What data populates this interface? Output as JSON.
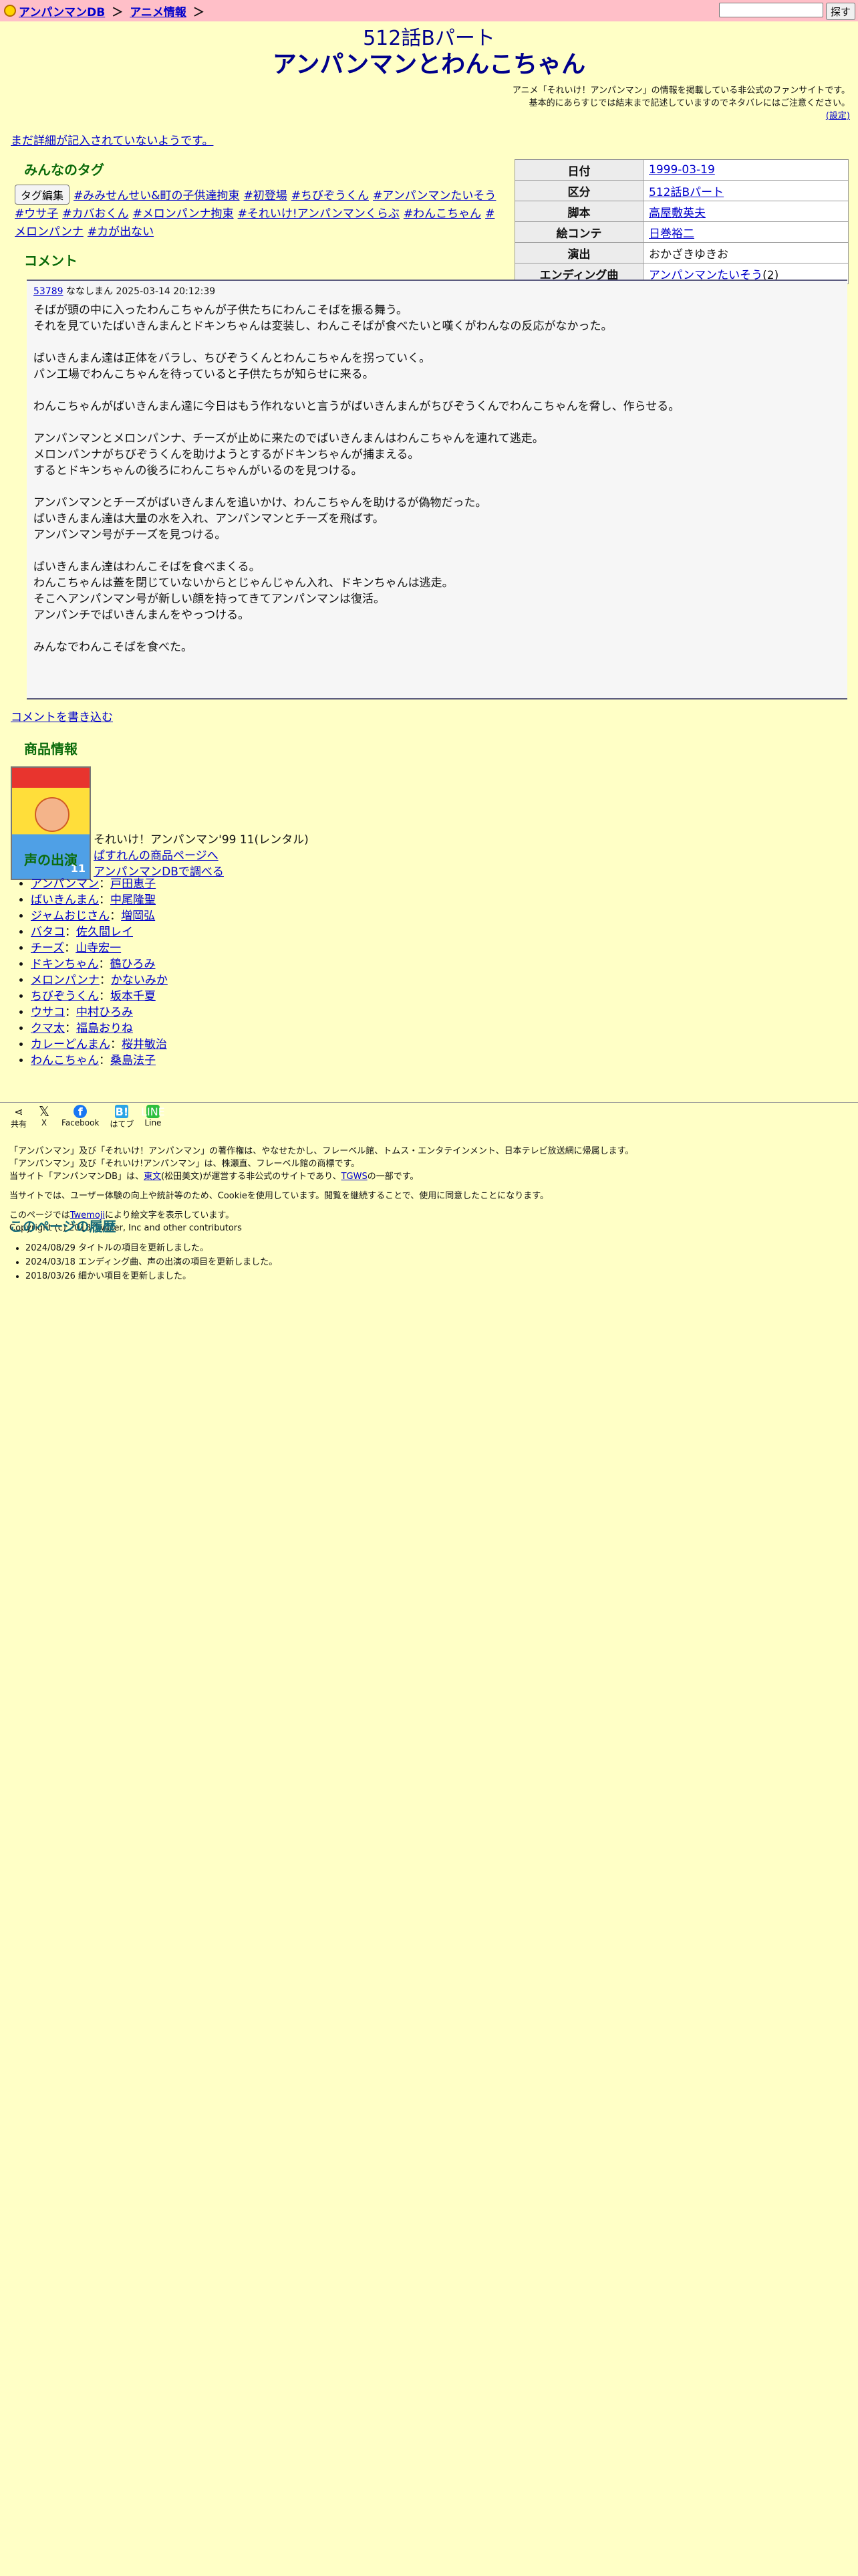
{
  "breadcrumb": {
    "home": "アンパンマンDB",
    "sep": "＞",
    "section": "アニメ情報"
  },
  "search": {
    "button": "探す"
  },
  "title": {
    "sub": "512話Bパート",
    "main": "アンパンマンとわんこちゃん"
  },
  "notice": {
    "line1": "アニメ「それいけ！アンパンマン」の情報を掲載している非公式のファンサイトです。",
    "line2": "基本的にあらすじでは結末まで記述していますのでネタバレにはご注意ください。",
    "settings": "(設定)"
  },
  "no_detail": "まだ詳細が記入されていないようです。",
  "tags": {
    "heading": "みんなのタグ",
    "edit": "タグ編集",
    "items": [
      "#みみせんせい&町の子供達拘束",
      "#初登場",
      "#ちびぞうくん",
      "#アンパンマンたいそう",
      "#ウサ子",
      "#カバおくん",
      "#メロンパンナ拘束",
      "#それいけ!アンパンマンくらぶ",
      "#わんこちゃん",
      "#メロンパンナ",
      "#カが出ない"
    ]
  },
  "info": {
    "rows": [
      {
        "label": "日付",
        "value": "1999-03-19",
        "link": true
      },
      {
        "label": "区分",
        "value": "512話Bパート",
        "link": true
      },
      {
        "label": "脚本",
        "value": "高屋敷英夫",
        "link": true
      },
      {
        "label": "絵コンテ",
        "value": "日巻裕二",
        "link": true
      },
      {
        "label": "演出",
        "value": "おかざきゆきお",
        "link": false
      },
      {
        "label": "エンディング曲",
        "value": "アンパンマンたいそう",
        "suffix": "(2)",
        "link": true
      }
    ]
  },
  "comment": {
    "heading": "コメント",
    "id": "53789",
    "author": "ななしまん",
    "date": "2025-03-14 20:12:39",
    "lines": [
      "そばが頭の中に入ったわんこちゃんが子供たちにわんこそばを振る舞う。",
      "それを見ていたばいきんまんとドキンちゃんは変装し、わんこそばが食べたいと嘆くがわんなの反応がなかった。",
      "",
      "ばいきんまん達は正体をバラし、ちびぞうくんとわんこちゃんを拐っていく。",
      "パン工場でわんこちゃんを待っていると子供たちが知らせに来る。",
      "",
      "わんこちゃんがばいきんまん達に今日はもう作れないと言うがばいきんまんがちびぞうくんでわんこちゃんを脅し、作らせる。",
      "",
      "アンパンマンとメロンパンナ、チーズが止めに来たのでばいきんまんはわんこちゃんを連れて逃走。",
      "メロンパンナがちびぞうくんを助けようとするがドキンちゃんが捕まえる。",
      "するとドキンちゃんの後ろにわんこちゃんがいるのを見つける。",
      "",
      "アンパンマンとチーズがばいきんまんを追いかけ、わんこちゃんを助けるが偽物だった。",
      "ばいきんまん達は大量の水を入れ、アンパンマンとチーズを飛ばす。",
      "アンパンマン号がチーズを見つける。",
      "",
      "ばいきんまん達はわんこそばを食べまくる。",
      "わんこちゃんは蓋を閉じていないからとじゃんじゃん入れ、ドキンちゃんは逃走。",
      "そこへアンパンマン号が新しい顔を持ってきてアンパンマンは復活。",
      "アンパンチでばいきんまんをやっつける。",
      "",
      "みんなでわんこそばを食べた。"
    ],
    "write": "コメントを書き込む"
  },
  "product": {
    "heading": "商品情報",
    "cover_num": "11",
    "title": "それいけ！アンパンマン'99 11(レンタル)",
    "link1": "ぱすれんの商品ページへ",
    "link2": "アンパンマンDBで調べる"
  },
  "cast": {
    "heading": "声の出演",
    "items": [
      {
        "role": "アンパンマン",
        "actor": "戸田恵子"
      },
      {
        "role": "ばいきんまん",
        "actor": "中尾隆聖"
      },
      {
        "role": "ジャムおじさん",
        "actor": "増岡弘"
      },
      {
        "role": "バタコ",
        "actor": "佐久間レイ"
      },
      {
        "role": "チーズ",
        "actor": "山寺宏一"
      },
      {
        "role": "ドキンちゃん",
        "actor": "鶴ひろみ"
      },
      {
        "role": "メロンパンナ",
        "actor": "かないみか"
      },
      {
        "role": "ちびぞうくん",
        "actor": "坂本千夏"
      },
      {
        "role": "ウサコ",
        "actor": "中村ひろみ"
      },
      {
        "role": "クマ太",
        "actor": "福島おりね"
      },
      {
        "role": "カレーどんまん",
        "actor": "桜井敏治"
      },
      {
        "role": "わんこちゃん",
        "actor": "桑島法子"
      }
    ]
  },
  "share": {
    "label": "共有",
    "x": "X",
    "facebook": "Facebook",
    "hatena": "はてブ",
    "line": "Line"
  },
  "footer": {
    "l1": "「アンパンマン」及び「それいけ！アンパンマン」の著作権は、やなせたかし、フレーベル館、トムス・エンタテインメント、日本テレビ放送網に帰属します。",
    "l2": "「アンパンマン」及び「それいけ!アンパンマン」は、株瀬直、フレーベル館の商標です。",
    "l3a": "当サイト「アンパンマンDB」は、",
    "l3link": "東文",
    "l3b": "(松田美文)が運営する非公式のサイトであり、",
    "l3link2": "TGWS",
    "l3c": "の一部です。",
    "l4": "当サイトでは、ユーザー体験の向上や統計等のため、Cookieを使用しています。閲覧を継続することで、使用に同意したことになります。",
    "l5a": "このページでは",
    "l5link": "Twemoji",
    "l5b": "により絵文字を表示しています。",
    "l6": "Copyright (c) 2018 Twitter, Inc and other contributors"
  },
  "history": {
    "heading": "このページの履歴",
    "items": [
      "2024/08/29 タイトルの項目を更新しました。",
      "2024/03/18 エンディング曲、声の出演の項目を更新しました。",
      "2018/03/26 細かい項目を更新しました。"
    ]
  }
}
